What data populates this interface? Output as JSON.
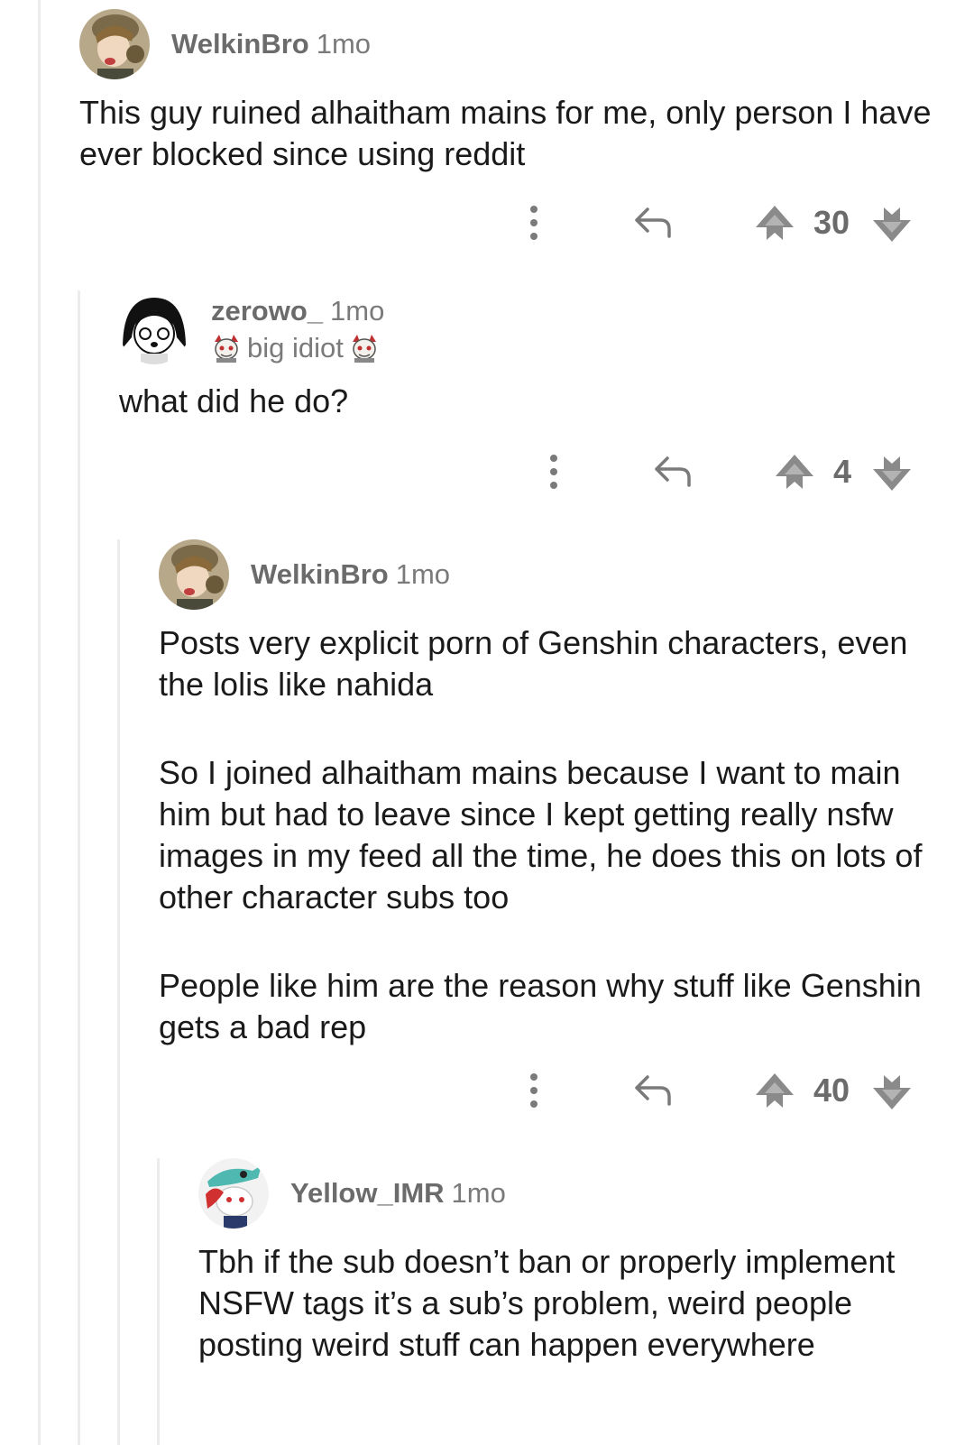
{
  "comments": [
    {
      "author": "WelkinBro",
      "age": "1mo",
      "avatar": "soldier-avatar-icon",
      "paragraphs": [
        "This guy ruined alhaitham mains for me, only person I have ever blocked since using reddit"
      ],
      "score": "30"
    },
    {
      "author": "zerowo_",
      "age": "1mo",
      "avatar": "anime-girl-avatar-icon",
      "flair": "big idiot",
      "paragraphs": [
        "what did he do?"
      ],
      "score": "4"
    },
    {
      "author": "WelkinBro",
      "age": "1mo",
      "avatar": "soldier-avatar-icon",
      "paragraphs": [
        "Posts very explicit porn of Genshin characters, even the lolis like nahida",
        "So I joined alhaitham mains because I want to main him but had to leave since I kept getting really nsfw images in my feed all the time, he does this on lots of other character subs too",
        "People like him are the reason why stuff like Genshin gets a bad rep"
      ],
      "score": "40"
    },
    {
      "author": "Yellow_IMR",
      "age": "1mo",
      "avatar": "snoo-shark-hat-avatar-icon",
      "paragraphs": [
        "Tbh if the sub doesn’t ban or properly implement NSFW tags it’s a sub’s problem, weird people posting weird stuff can happen everywhere"
      ]
    }
  ],
  "icons": {
    "more": "vertical-dots-icon",
    "reply": "reply-arrow-icon",
    "upvote": "upvote-arrow-icon",
    "downvote": "downvote-arrow-icon"
  },
  "colors": {
    "text": "#1a1a1b",
    "meta": "#7a7a7a",
    "thread_line": "#ececec"
  }
}
